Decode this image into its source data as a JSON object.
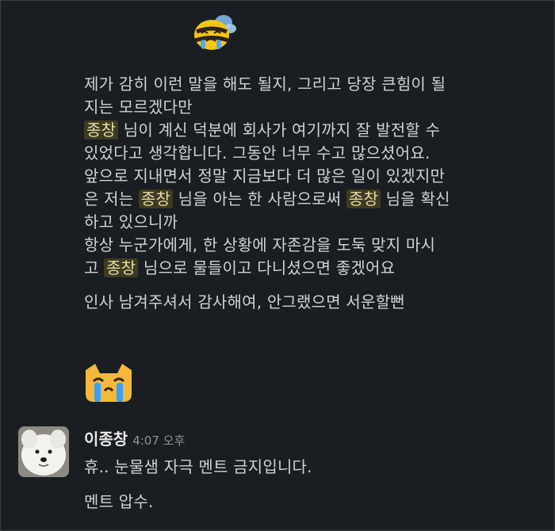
{
  "emoji_top": "crying-bee-emoji",
  "message": {
    "lines": [
      [
        {
          "t": "제가 감히 이런 말을 해도 될지, 그리고 당장 큰힘이 될"
        }
      ],
      [
        {
          "t": "지는 모르겠다만"
        }
      ],
      [
        {
          "m": "종창"
        },
        {
          "t": " 님이 계신 덕분에 회사가 여기까지 잘 발전할 수"
        }
      ],
      [
        {
          "t": "있었다고 생각합니다. 그동안 너무 수고 많으셨어요."
        }
      ],
      [
        {
          "t": "앞으로 지내면서 정말 지금보다 더 많은 일이 있겠지만"
        }
      ],
      [
        {
          "t": "은 저는 "
        },
        {
          "m": "종창"
        },
        {
          "t": " 님을 아는 한 사람으로써 "
        },
        {
          "m": "종창"
        },
        {
          "t": " 님을 확신"
        }
      ],
      [
        {
          "t": "하고 있으니까"
        }
      ],
      [
        {
          "t": "항상 누군가에게, 한 상황에 자존감을 도둑 맞지 마시"
        }
      ],
      [
        {
          "t": "고 "
        },
        {
          "m": "종창"
        },
        {
          "t": " 님으로 물들이고 다니셨으면 좋겠어요"
        }
      ]
    ],
    "followup": "인사 남겨주셔서 감사해여, 안그랬으면 서운할뻔"
  },
  "emoji_bottom": "crying-cat-emoji",
  "reply": {
    "author": "이종창",
    "time": "4:07 오후",
    "lines": [
      "휴.. 눈물샘 자극 멘트 금지입니다.",
      "멘트 압수."
    ]
  },
  "colors": {
    "background": "#1a1d21",
    "text": "#d1d2d3",
    "mention_bg": "#3e3b22",
    "mention_text": "#e8dca6",
    "timestamp": "#8e9196"
  }
}
